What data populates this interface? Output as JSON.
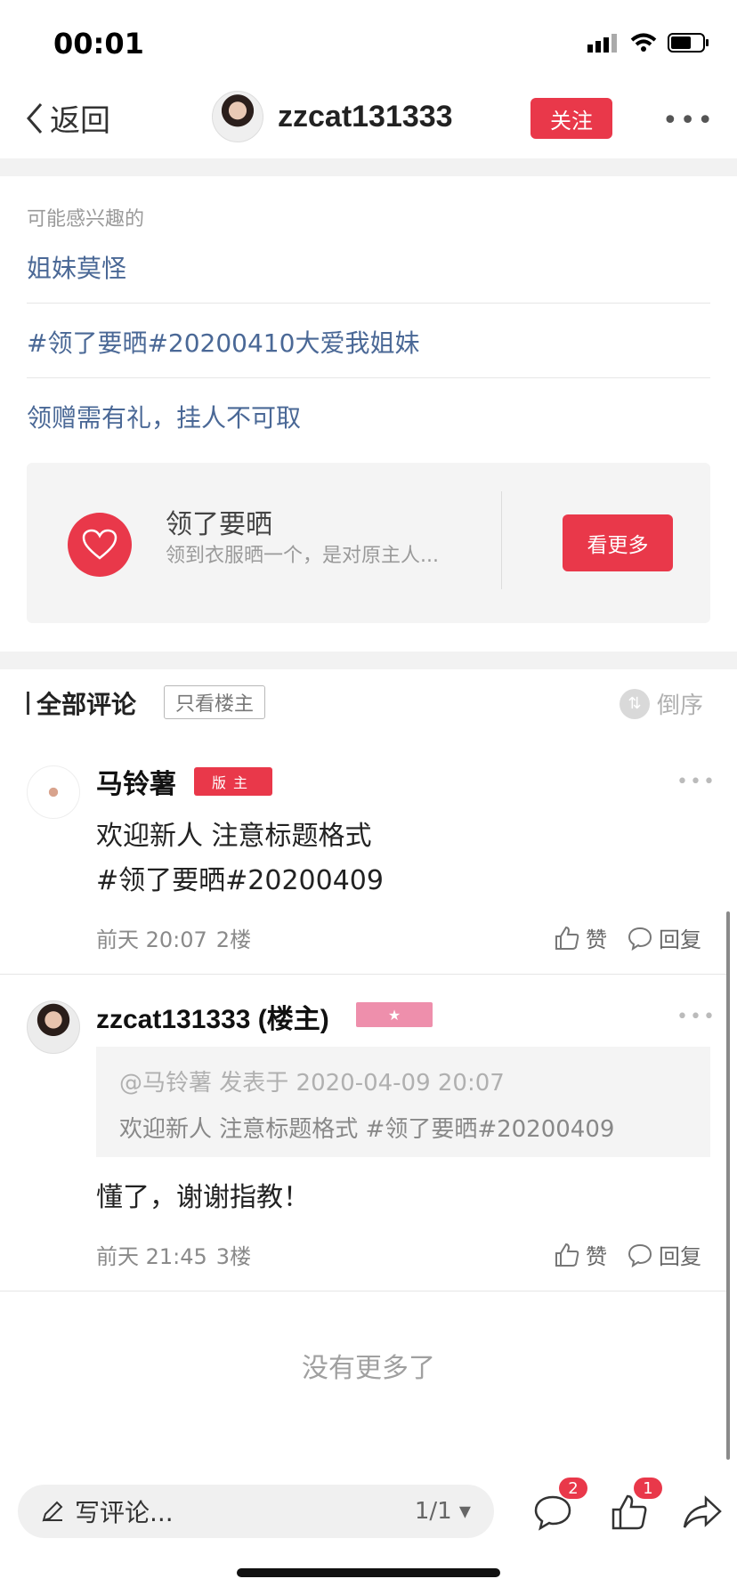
{
  "status": {
    "time": "00:01"
  },
  "header": {
    "back_label": "返回",
    "username": "zzcat131333",
    "follow_label": "关注"
  },
  "interests": {
    "title": "可能感兴趣的",
    "links": [
      "姐妹莫怪",
      "#领了要晒#20200410大爱我姐妹",
      "领赠需有礼，挂人不可取"
    ]
  },
  "topic_card": {
    "name": "领了要晒",
    "desc": "领到衣服晒一个，是对原主人...",
    "button": "看更多"
  },
  "comments_header": {
    "title": "全部评论",
    "only_op": "只看楼主",
    "sort": "倒序"
  },
  "comments": [
    {
      "name": "马铃薯",
      "badge": "版主",
      "body_lines": [
        "欢迎新人 注意标题格式",
        "#领了要晒#20200409"
      ],
      "time": "前天 20:07",
      "floor": "2楼",
      "like": "赞",
      "reply": "回复"
    },
    {
      "name": "zzcat131333 (楼主)",
      "badge": "★",
      "quote_head": "@马铃薯 发表于 2020-04-09 20:07",
      "quote_body": "欢迎新人 注意标题格式 #领了要晒#20200409",
      "body_lines": [
        "懂了，谢谢指教！"
      ],
      "time": "前天 21:45",
      "floor": "3楼",
      "like": "赞",
      "reply": "回复"
    }
  ],
  "footer_text": "没有更多了",
  "bottom_bar": {
    "input_placeholder": "写评论...",
    "page_indicator": "1/1",
    "comment_count": "2",
    "like_count": "1"
  },
  "colors": {
    "accent": "#e9384a",
    "link": "#4a6896",
    "star_badge": "#ee8fac"
  }
}
